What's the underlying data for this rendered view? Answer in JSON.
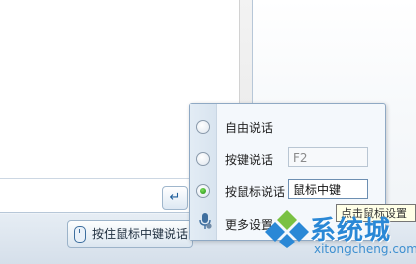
{
  "chat": {
    "send_icon": "enter-arrow-icon",
    "push_to_talk_label": "按住鼠标中键说话"
  },
  "voice_popup": {
    "options": [
      {
        "label": "自由说话",
        "selected": false
      },
      {
        "label": "按键说话",
        "selected": false,
        "key_value": "F2"
      },
      {
        "label": "按鼠标说话",
        "selected": true,
        "key_value": "鼠标中键"
      }
    ],
    "more_settings_label": "更多设置",
    "tooltip": "点击鼠标设置"
  },
  "watermark": {
    "brand": "系统城",
    "url": "xitongcheng.com"
  },
  "colors": {
    "accent": "#2a88d6",
    "selected_radio": "#1f8a12"
  }
}
